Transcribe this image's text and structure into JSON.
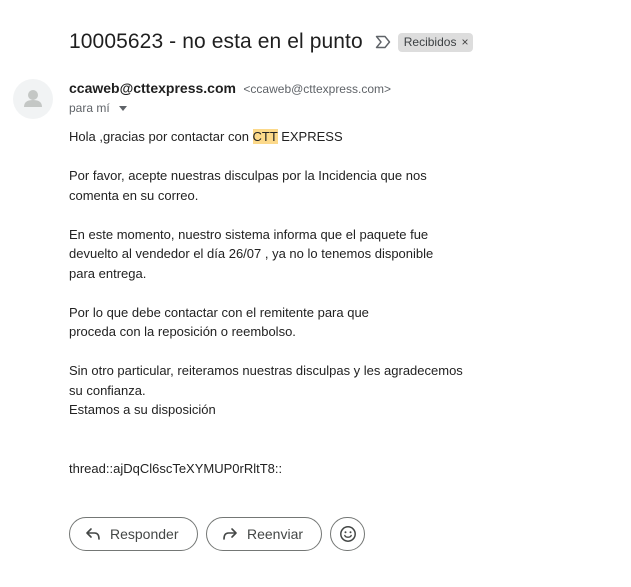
{
  "email": {
    "subject": "10005623 - no esta en el punto",
    "label_chip": {
      "text": "Recibidos",
      "close_glyph": "×"
    },
    "sender": {
      "name": "ccaweb@cttexpress.com",
      "address": "<ccaweb@cttexpress.com>"
    },
    "recipient_summary": "para mí",
    "body": {
      "greeting_prefix": "Hola ,gracias por contactar con ",
      "greeting_highlight": "CTT",
      "greeting_suffix": " EXPRESS",
      "para1_line1": "Por favor, acepte nuestras disculpas por la Incidencia que nos",
      "para1_line2": "comenta en su correo.",
      "para2_line1": "En este momento, nuestro sistema informa que el paquete fue",
      "para2_line2": "devuelto al vendedor el día 26/07 , ya no lo tenemos disponible",
      "para2_line3": "para entrega.",
      "para3_line1": "Por lo que debe contactar con el remitente para que",
      "para3_line2": "proceda con la reposición o reembolso.",
      "para4_line1": "Sin otro particular, reiteramos nuestras disculpas y les agradecemos",
      "para4_line2": "su confianza.",
      "para4_line3": "Estamos a su disposición",
      "thread_id": "thread::ajDqCl6scTeXYMUP0rRltT8::"
    }
  },
  "actions": {
    "reply_label": "Responder",
    "forward_label": "Reenviar"
  },
  "icons": {
    "importance": "importance-marker-icon",
    "avatar": "person-icon",
    "reply": "reply-icon",
    "forward": "forward-icon",
    "emoji": "emoji-icon"
  },
  "colors": {
    "highlight": "#fcd98a",
    "chip_background": "#dddddd",
    "button_border": "#747775"
  }
}
